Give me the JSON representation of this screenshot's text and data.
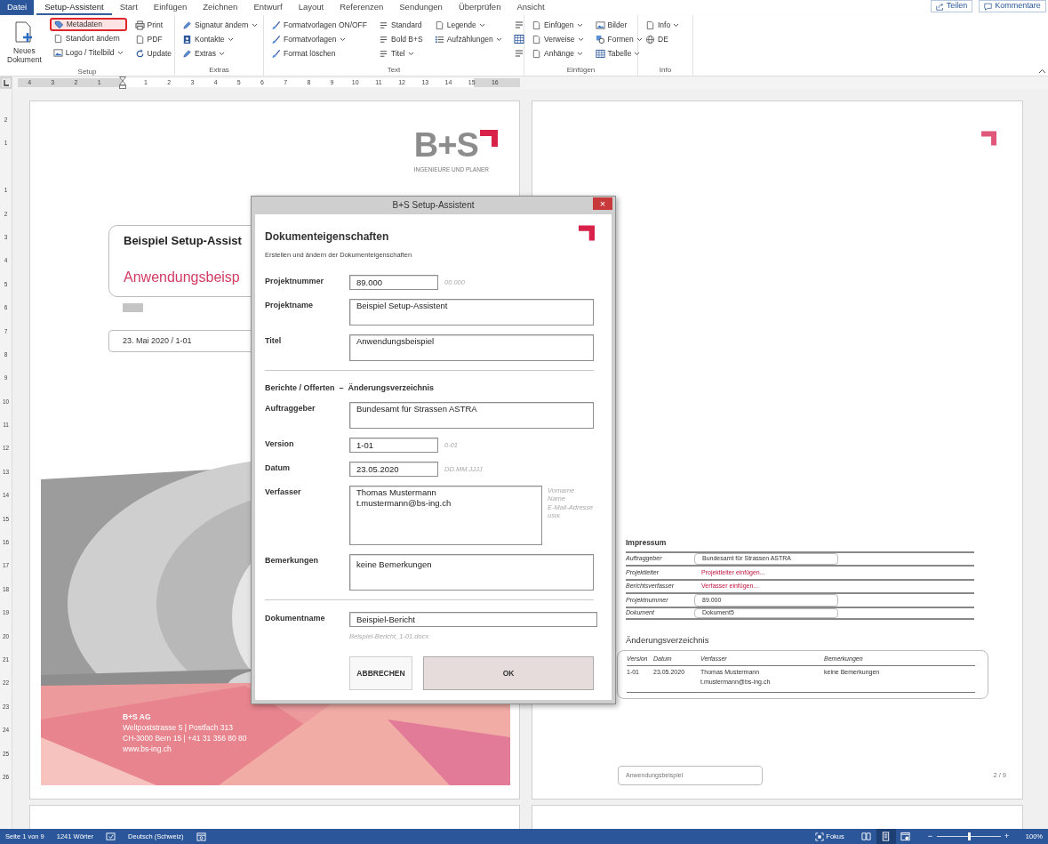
{
  "tabs": [
    {
      "label": "Datei",
      "kind": "file",
      "selected": false
    },
    {
      "label": "Setup-Assistent",
      "kind": "tab",
      "selected": true
    },
    {
      "label": "Start",
      "kind": "tab",
      "selected": false
    },
    {
      "label": "Einfügen",
      "kind": "tab",
      "selected": false
    },
    {
      "label": "Zeichnen",
      "kind": "tab",
      "selected": false
    },
    {
      "label": "Entwurf",
      "kind": "tab",
      "selected": false
    },
    {
      "label": "Layout",
      "kind": "tab",
      "selected": false
    },
    {
      "label": "Referenzen",
      "kind": "tab",
      "selected": false
    },
    {
      "label": "Sendungen",
      "kind": "tab",
      "selected": false
    },
    {
      "label": "Überprüfen",
      "kind": "tab",
      "selected": false
    },
    {
      "label": "Ansicht",
      "kind": "tab",
      "selected": false
    }
  ],
  "header_buttons": [
    {
      "label": "Teilen",
      "kind": "share"
    },
    {
      "label": "Kommentare",
      "kind": "comment"
    }
  ],
  "ribbon": {
    "groups": [
      {
        "label": "Setup",
        "columns": [
          {
            "kind": "large",
            "items": [
              {
                "label": "Neues\nDokument",
                "dropdown": false,
                "highlighted": false
              }
            ]
          },
          {
            "kind": "small",
            "items": [
              {
                "label": "Metadaten",
                "dropdown": false,
                "highlighted": true
              },
              {
                "label": "Standort ändern",
                "dropdown": false,
                "highlighted": false
              },
              {
                "label": "Logo / Titelbild",
                "dropdown": true,
                "highlighted": false
              }
            ]
          },
          {
            "kind": "small",
            "items": [
              {
                "label": "Print",
                "dropdown": false,
                "highlighted": false
              },
              {
                "label": "PDF",
                "dropdown": false,
                "highlighted": false
              },
              {
                "label": "Update",
                "dropdown": false,
                "highlighted": false
              }
            ]
          }
        ]
      },
      {
        "label": "Extras",
        "columns": [
          {
            "kind": "small",
            "items": [
              {
                "label": "Signatur ändern",
                "dropdown": true,
                "highlighted": false
              },
              {
                "label": "Kontakte",
                "dropdown": true,
                "highlighted": false
              },
              {
                "label": "Extras",
                "dropdown": true,
                "highlighted": false
              }
            ]
          }
        ]
      },
      {
        "label": "Text",
        "columns": [
          {
            "kind": "small",
            "items": [
              {
                "label": "Formatvorlagen ON/OFF",
                "dropdown": false,
                "highlighted": false
              },
              {
                "label": "Formatvorlagen",
                "dropdown": true,
                "highlighted": false
              },
              {
                "label": "Format löschen",
                "dropdown": false,
                "highlighted": false
              }
            ]
          },
          {
            "kind": "small",
            "items": [
              {
                "label": "Standard",
                "dropdown": false,
                "highlighted": false
              },
              {
                "label": "Bold B+S",
                "dropdown": false,
                "highlighted": false
              },
              {
                "label": "Titel",
                "dropdown": true,
                "highlighted": false
              }
            ]
          },
          {
            "kind": "small",
            "items": [
              {
                "label": "Legende",
                "dropdown": true,
                "highlighted": false
              },
              {
                "label": "Aufzählungen",
                "dropdown": true,
                "highlighted": false
              }
            ]
          },
          {
            "kind": "icons",
            "items": [
              {
                "dropdown": false,
                "highlighted": false
              },
              {
                "dropdown": false,
                "highlighted": false
              },
              {
                "dropdown": false,
                "highlighted": false
              }
            ]
          }
        ]
      },
      {
        "label": "Einfügen",
        "columns": [
          {
            "kind": "small",
            "items": [
              {
                "label": "Einfügen",
                "dropdown": true,
                "highlighted": false
              },
              {
                "label": "Verweise",
                "dropdown": true,
                "highlighted": false
              },
              {
                "label": "Anhänge",
                "dropdown": true,
                "highlighted": false
              }
            ]
          },
          {
            "kind": "small",
            "items": [
              {
                "label": "Bilder",
                "dropdown": false,
                "highlighted": false
              },
              {
                "label": "Formen",
                "dropdown": true,
                "highlighted": false
              },
              {
                "label": "Tabelle",
                "dropdown": true,
                "highlighted": false
              }
            ]
          }
        ]
      },
      {
        "label": "Info",
        "columns": [
          {
            "kind": "small",
            "items": [
              {
                "label": "Info",
                "dropdown": true,
                "highlighted": false
              },
              {
                "label": "DE",
                "dropdown": false,
                "highlighted": false
              }
            ]
          }
        ]
      }
    ]
  },
  "ruler": {
    "left_labels": [
      "4",
      "3",
      "2",
      "1"
    ],
    "right_labels": [
      "1",
      "2",
      "3",
      "4",
      "5",
      "6",
      "7",
      "8",
      "9",
      "10",
      "11",
      "12",
      "13",
      "14",
      "15",
      "16"
    ]
  },
  "vertical_ruler": {
    "top_labels": [
      "2",
      "1"
    ],
    "bottom_labels": [
      "1",
      "2",
      "3",
      "4",
      "5",
      "6",
      "7",
      "8",
      "9",
      "10",
      "11",
      "12",
      "13",
      "14",
      "15",
      "16",
      "17",
      "18",
      "19",
      "20",
      "21",
      "22",
      "23",
      "24",
      "25",
      "26"
    ]
  },
  "cover": {
    "logo": "B+S",
    "tagline": "INGENIEURE UND PLANER",
    "title": "Beispiel Setup-Assist",
    "subtitle": "Anwendungsbeisp",
    "date_line": "23. Mai 2020 / 1-01",
    "address": [
      "B+S AG",
      "Weltpoststrasse 5 | Postfach 313",
      "CH-3000 Bern 15 | +41 31 356 80 80",
      "www.bs-ing.ch"
    ]
  },
  "page2": {
    "impressum_title": "Impressum",
    "impressum": [
      {
        "label": "Auftraggeber",
        "value": "Bundesamt für Strassen ASTRA",
        "kind": "value"
      },
      {
        "label": "Projektleiter",
        "value": "Projektleiter einfügen...",
        "kind": "prompt"
      },
      {
        "label": "Berichtsverfasser",
        "value": "Verfasser einfügen...",
        "kind": "prompt"
      },
      {
        "label": "Projektnummer",
        "value": "89.000",
        "kind": "value"
      },
      {
        "label": "Dokument",
        "value": "Dokument5",
        "kind": "value"
      }
    ],
    "changes_title": "Änderungsverzeichnis",
    "changes_columns": [
      "Version",
      "Datum",
      "Verfasser",
      "Bemerkungen"
    ],
    "changes_rows": [
      [
        "1-01",
        "23.05.2020",
        "Thomas Mustermann\nt.mustermann@bs-ing.ch",
        "keine Bemerkungen"
      ]
    ],
    "footer_title": "Anwendungsbeispiel",
    "page_number": "2 / 9"
  },
  "dialog": {
    "title": "B+S Setup-Assistent",
    "close_label": "×",
    "heading": "Dokumenteigenschaften",
    "subtitle": "Erstellen und ändern der Dokumenteigenschaften",
    "sections": [
      {
        "fields": [
          {
            "label": "Projektnummer",
            "value": "89.000",
            "kind": "short",
            "hint": "00.000"
          },
          {
            "label": "Projektname",
            "value": "Beispiel Setup-Assistent",
            "kind": "wide"
          },
          {
            "label": "Titel",
            "value": "Anwendungsbeispiel",
            "kind": "wide"
          }
        ]
      },
      {
        "title": "Berichte / Offerten  –  Änderungsverzeichnis",
        "fields": [
          {
            "label": "Auftraggeber",
            "value": "Bundesamt für Strassen ASTRA",
            "kind": "wide"
          },
          {
            "label": "Version",
            "value": "1-01",
            "kind": "short",
            "hint": "0-01"
          },
          {
            "label": "Datum",
            "value": "23.05.2020",
            "kind": "short",
            "hint": "DD.MM.JJJJ"
          },
          {
            "label": "Verfasser",
            "value": "Thomas Mustermann\nt.mustermann@bs-ing.ch",
            "kind": "area",
            "hint": "Vorname Name\nE-Mail-Adresse\nusw."
          },
          {
            "label": "Bemerkungen",
            "value": "keine Bemerkungen",
            "kind": "tall"
          }
        ]
      },
      {
        "fields": [
          {
            "label": "Dokumentname",
            "value": "Beispiel-Bericht",
            "kind": "line",
            "hint": "Beispiel-Bericht_1-01.docx"
          }
        ]
      }
    ],
    "buttons": [
      {
        "label": "ABBRECHEN",
        "kind": "secondary"
      },
      {
        "label": "OK",
        "kind": "primary"
      }
    ]
  },
  "status_bar": {
    "left": [
      "Seite 1 von 9",
      "1241 Wörter"
    ],
    "language": "Deutsch (Schweiz)",
    "focus": "Fokus",
    "views": [
      {
        "selected": false
      },
      {
        "selected": true
      },
      {
        "selected": false
      }
    ],
    "zoom_out": "−",
    "zoom_in": "+",
    "zoom": {
      "level": 0.5
    },
    "zoom_label": "100%"
  }
}
